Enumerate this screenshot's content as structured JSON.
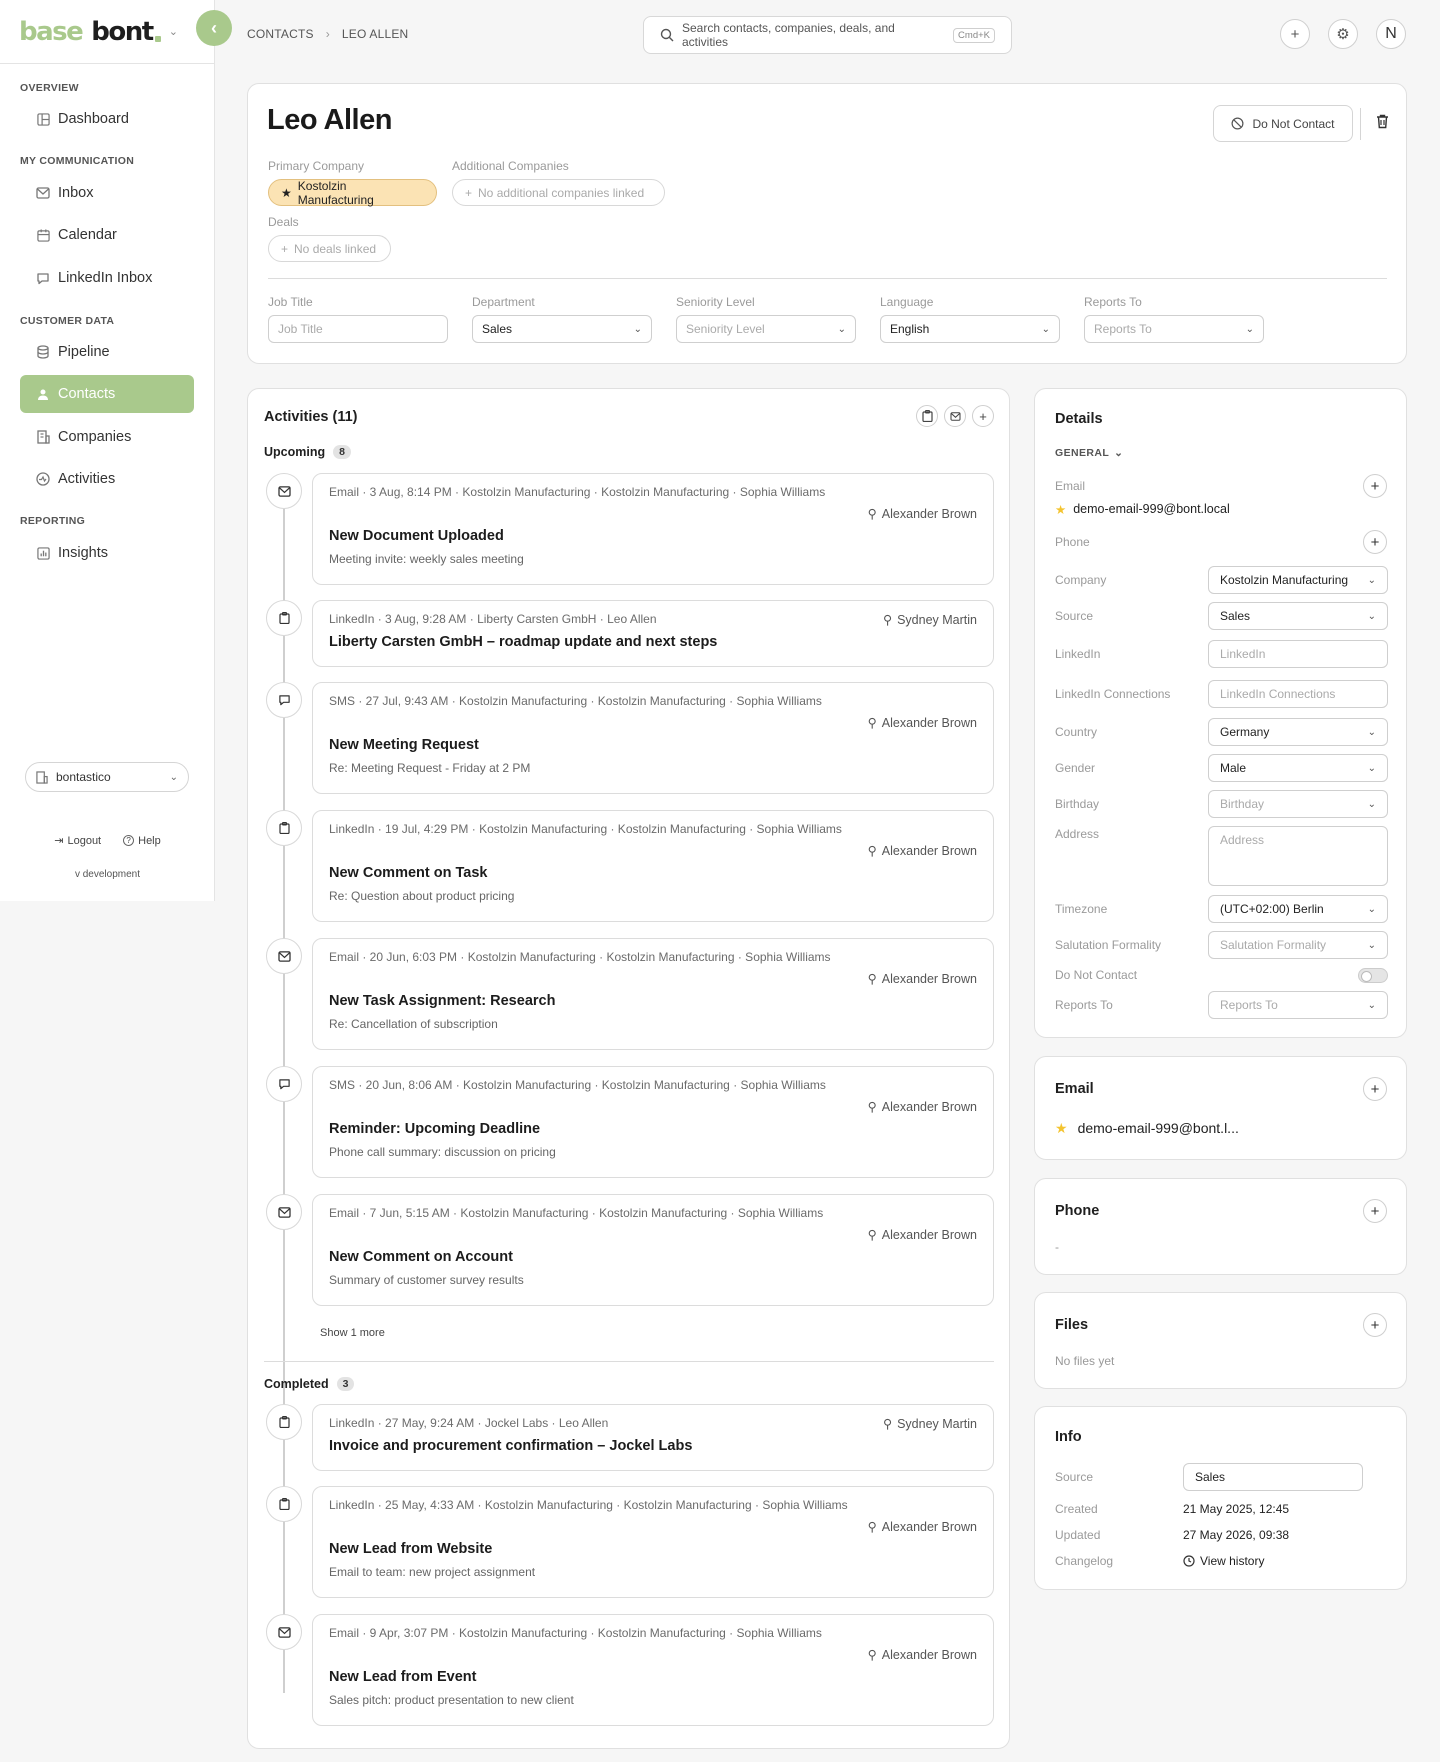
{
  "brand": {
    "part1": "base",
    "part2": "bont"
  },
  "sidebar": {
    "sections": [
      {
        "label": "OVERVIEW"
      },
      {
        "label": "MY COMMUNICATION"
      },
      {
        "label": "CUSTOMER DATA"
      },
      {
        "label": "REPORTING"
      }
    ],
    "items": [
      {
        "label": "Dashboard",
        "icon": "dashboard-icon"
      },
      {
        "label": "Inbox",
        "icon": "mail-icon"
      },
      {
        "label": "Calendar",
        "icon": "calendar-icon"
      },
      {
        "label": "LinkedIn Inbox",
        "icon": "chat-icon"
      },
      {
        "label": "Pipeline",
        "icon": "database-icon"
      },
      {
        "label": "Contacts",
        "icon": "contacts-icon",
        "active": true
      },
      {
        "label": "Companies",
        "icon": "building-icon"
      },
      {
        "label": "Activities",
        "icon": "activity-icon"
      },
      {
        "label": "Insights",
        "icon": "chart-icon"
      }
    ],
    "workspace": "bontastico",
    "logout": "Logout",
    "help": "Help",
    "version": "v development"
  },
  "breadcrumb": {
    "root": "CONTACTS",
    "current": "LEO ALLEN"
  },
  "search": {
    "placeholder": "Search contacts, companies, deals, and activities",
    "shortcut": "Cmd+K"
  },
  "topbar": {
    "avatar_initial": "N"
  },
  "contact": {
    "name": "Leo Allen",
    "do_not_contact_label": "Do Not Contact",
    "primary_company_label": "Primary Company",
    "primary_company": "Kostolzin Manufacturing",
    "additional_companies_label": "Additional Companies",
    "additional_companies_empty": "No additional companies linked",
    "deals_label": "Deals",
    "deals_empty": "No deals linked",
    "fields": [
      {
        "label": "Job Title",
        "value": "",
        "placeholder": "Job Title",
        "type": "input"
      },
      {
        "label": "Department",
        "value": "Sales",
        "placeholder": "",
        "type": "select"
      },
      {
        "label": "Seniority Level",
        "value": "",
        "placeholder": "Seniority Level",
        "type": "select"
      },
      {
        "label": "Language",
        "value": "English",
        "placeholder": "",
        "type": "select"
      },
      {
        "label": "Reports To",
        "value": "",
        "placeholder": "Reports To",
        "type": "select"
      }
    ]
  },
  "activities": {
    "title": "Activities (11)",
    "upcoming_label": "Upcoming",
    "upcoming_count": "8",
    "completed_label": "Completed",
    "completed_count": "3",
    "show_more": "Show 1 more",
    "upcoming": [
      {
        "type": "Email",
        "icon": "mail-icon",
        "meta": "Email · 3 Aug, 8:14 PM · Kostolzin Manufacturing · Kostolzin Manufacturing · Sophia Williams",
        "owner": "Alexander Brown",
        "title": "New Document Uploaded",
        "subtitle": "Meeting invite: weekly sales meeting"
      },
      {
        "type": "LinkedIn",
        "icon": "linkedin-icon",
        "meta": "LinkedIn · 3 Aug, 9:28 AM · Liberty Carsten GmbH · Leo Allen",
        "owner": "Sydney Martin",
        "title": "Liberty Carsten GmbH – roadmap update and next steps",
        "subtitle": ""
      },
      {
        "type": "SMS",
        "icon": "chat-bubble-icon",
        "meta": "SMS · 27 Jul, 9:43 AM · Kostolzin Manufacturing · Kostolzin Manufacturing · Sophia Williams",
        "owner": "Alexander Brown",
        "title": "New Meeting Request",
        "subtitle": "Re: Meeting Request - Friday at 2 PM"
      },
      {
        "type": "LinkedIn",
        "icon": "linkedin-icon",
        "meta": "LinkedIn · 19 Jul, 4:29 PM · Kostolzin Manufacturing · Kostolzin Manufacturing · Sophia Williams",
        "owner": "Alexander Brown",
        "title": "New Comment on Task",
        "subtitle": "Re: Question about product pricing"
      },
      {
        "type": "Email",
        "icon": "mail-icon",
        "meta": "Email · 20 Jun, 6:03 PM · Kostolzin Manufacturing · Kostolzin Manufacturing · Sophia Williams",
        "owner": "Alexander Brown",
        "title": "New Task Assignment: Research",
        "subtitle": "Re: Cancellation of subscription"
      },
      {
        "type": "SMS",
        "icon": "chat-bubble-icon",
        "meta": "SMS · 20 Jun, 8:06 AM · Kostolzin Manufacturing · Kostolzin Manufacturing · Sophia Williams",
        "owner": "Alexander Brown",
        "title": "Reminder: Upcoming Deadline",
        "subtitle": "Phone call summary: discussion on pricing"
      },
      {
        "type": "Email",
        "icon": "mail-icon",
        "meta": "Email · 7 Jun, 5:15 AM · Kostolzin Manufacturing · Kostolzin Manufacturing · Sophia Williams",
        "owner": "Alexander Brown",
        "title": "New Comment on Account",
        "subtitle": "Summary of customer survey results"
      }
    ],
    "completed": [
      {
        "type": "LinkedIn",
        "icon": "linkedin-icon",
        "meta": "LinkedIn · 27 May, 9:24 AM · Jockel Labs · Leo Allen",
        "owner": "Sydney Martin",
        "title": "Invoice and procurement confirmation – Jockel Labs",
        "subtitle": ""
      },
      {
        "type": "LinkedIn",
        "icon": "linkedin-icon",
        "meta": "LinkedIn · 25 May, 4:33 AM · Kostolzin Manufacturing · Kostolzin Manufacturing · Sophia Williams",
        "owner": "Alexander Brown",
        "title": "New Lead from Website",
        "subtitle": "Email to team: new project assignment"
      },
      {
        "type": "Email",
        "icon": "mail-icon",
        "meta": "Email · 9 Apr, 3:07 PM · Kostolzin Manufacturing · Kostolzin Manufacturing · Sophia Williams",
        "owner": "Alexander Brown",
        "title": "New Lead from Event",
        "subtitle": "Sales pitch: product presentation to new client"
      }
    ]
  },
  "details": {
    "title": "Details",
    "section": "GENERAL",
    "email_label": "Email",
    "email_value": "demo-email-999@bont.local",
    "phone_label": "Phone",
    "rows": [
      {
        "label": "Company",
        "value": "Kostolzin Manufacturing",
        "placeholder": "",
        "kind": "select"
      },
      {
        "label": "Source",
        "value": "Sales",
        "placeholder": "",
        "kind": "select"
      },
      {
        "label": "LinkedIn",
        "value": "",
        "placeholder": "LinkedIn",
        "kind": "input"
      },
      {
        "label": "LinkedIn Connections",
        "value": "",
        "placeholder": "LinkedIn Connections",
        "kind": "input"
      },
      {
        "label": "Country",
        "value": "Germany",
        "placeholder": "",
        "kind": "select"
      },
      {
        "label": "Gender",
        "value": "Male",
        "placeholder": "",
        "kind": "select"
      },
      {
        "label": "Birthday",
        "value": "",
        "placeholder": "Birthday",
        "kind": "select"
      },
      {
        "label": "Address",
        "value": "",
        "placeholder": "Address",
        "kind": "textarea"
      },
      {
        "label": "Timezone",
        "value": "(UTC+02:00) Berlin",
        "placeholder": "",
        "kind": "select"
      },
      {
        "label": "Salutation Formality",
        "value": "",
        "placeholder": "Salutation Formality",
        "kind": "select"
      },
      {
        "label": "Do Not Contact",
        "value": "",
        "placeholder": "",
        "kind": "toggle"
      },
      {
        "label": "Reports To",
        "value": "",
        "placeholder": "Reports To",
        "kind": "select"
      }
    ]
  },
  "email_card": {
    "title": "Email",
    "value": "demo-email-999@bont.l..."
  },
  "phone_card": {
    "title": "Phone",
    "value": "-"
  },
  "files_card": {
    "title": "Files",
    "empty": "No files yet"
  },
  "info_card": {
    "title": "Info",
    "source_label": "Source",
    "source_value": "Sales",
    "created_label": "Created",
    "created_value": "21 May 2025, 12:45",
    "updated_label": "Updated",
    "updated_value": "27 May 2026, 09:38",
    "changelog_label": "Changelog",
    "changelog_link": "View history"
  },
  "colors": {
    "accent": "#a9c98c",
    "primary_pill": "#fbe3b4",
    "star": "#f4c430"
  }
}
